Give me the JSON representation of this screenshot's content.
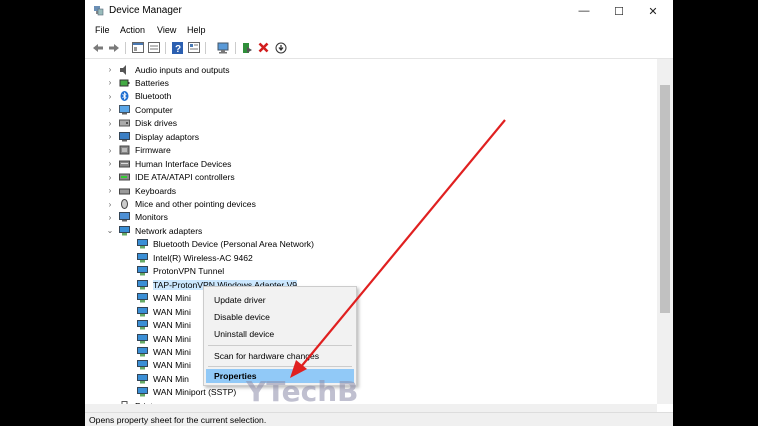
{
  "window": {
    "title": "Device Manager",
    "minimize_glyph": "—",
    "maximize_glyph": "☐",
    "close_glyph": "✕"
  },
  "menu": {
    "file": "File",
    "action": "Action",
    "view": "View",
    "help": "Help"
  },
  "tree": {
    "categories": [
      {
        "label": "Audio inputs and outputs",
        "icon": "speaker-icon"
      },
      {
        "label": "Batteries",
        "icon": "battery-icon"
      },
      {
        "label": "Bluetooth",
        "icon": "bluetooth-icon"
      },
      {
        "label": "Computer",
        "icon": "computer-icon"
      },
      {
        "label": "Disk drives",
        "icon": "disk-icon"
      },
      {
        "label": "Display adaptors",
        "icon": "display-icon"
      },
      {
        "label": "Firmware",
        "icon": "firmware-icon"
      },
      {
        "label": "Human Interface Devices",
        "icon": "hid-icon"
      },
      {
        "label": "IDE ATA/ATAPI controllers",
        "icon": "ide-icon"
      },
      {
        "label": "Keyboards",
        "icon": "keyboard-icon"
      },
      {
        "label": "Mice and other pointing devices",
        "icon": "mouse-icon"
      },
      {
        "label": "Monitors",
        "icon": "monitor-icon"
      },
      {
        "label": "Network adapters",
        "icon": "network-icon"
      }
    ],
    "network_children": [
      "Bluetooth Device (Personal Area Network)",
      "Intel(R) Wireless-AC 9462",
      "ProtonVPN Tunnel",
      "TAP-ProtonVPN Windows Adapter V9",
      "WAN Mini",
      "WAN Mini",
      "WAN Mini",
      "WAN Mini",
      "WAN Mini",
      "WAN Mini",
      "WAN Min",
      "WAN Miniport (SSTP)"
    ],
    "next_category": "Print queues"
  },
  "context_menu": {
    "update_driver": "Update driver",
    "disable_device": "Disable device",
    "uninstall_device": "Uninstall device",
    "scan_hardware": "Scan for hardware changes",
    "properties": "Properties"
  },
  "status_bar": "Opens property sheet for the current selection.",
  "watermark": "YTechB",
  "colors": {
    "selection": "#cce8ff",
    "arrow": "#e02020",
    "adapter_icon": "#3a8fd6"
  }
}
